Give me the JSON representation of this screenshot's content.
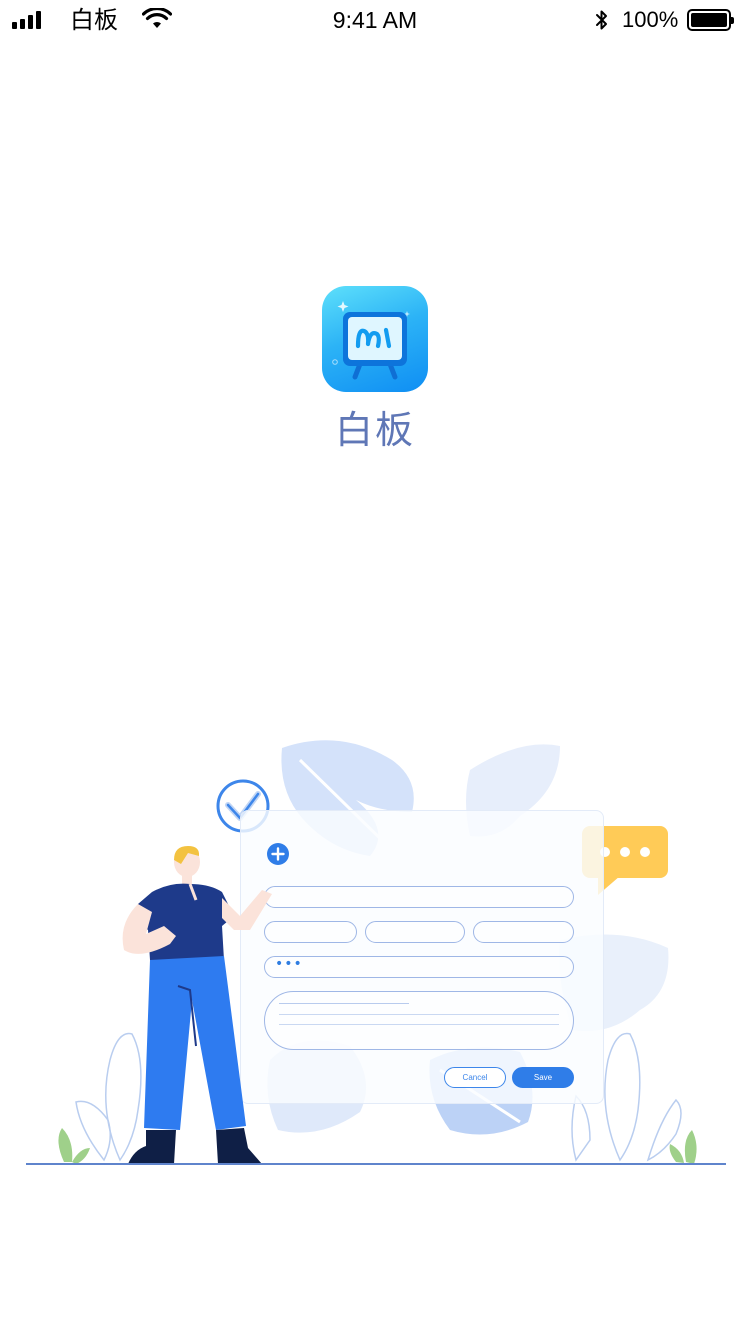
{
  "status_bar": {
    "carrier": "白板",
    "time": "9:41 AM",
    "battery_percent": "100%",
    "battery_level": 1.0,
    "icons": [
      "signal-icon",
      "wifi-icon",
      "bluetooth-icon",
      "battery-icon"
    ]
  },
  "app": {
    "name": "白板",
    "icon": "whiteboard-app-icon",
    "accent": "#1aa3f5",
    "name_color": "#5f77b6"
  },
  "illustration": {
    "form": {
      "password_mask": "•••",
      "cancel_label": "Cancel",
      "save_label": "Save"
    },
    "icons": [
      "check-circle-icon",
      "plus-circle-icon",
      "chat-bubble-icon"
    ],
    "colors": {
      "primary_blue": "#2f7de8",
      "speech_bubble": "#ffcb57",
      "leaf_light": "#d6e4fb"
    }
  }
}
